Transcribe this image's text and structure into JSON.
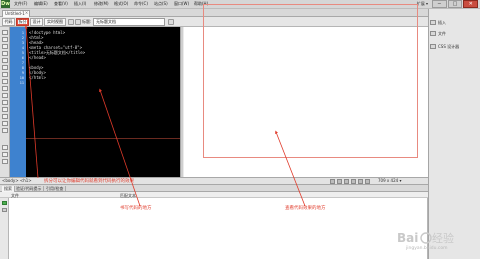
{
  "menubar": {
    "logo": "Dw",
    "items": [
      "文件(F)",
      "编辑(E)",
      "查看(V)",
      "插入(I)",
      "修改(M)",
      "格式(O)",
      "命令(C)",
      "站点(S)",
      "窗口(W)",
      "帮助(H)"
    ],
    "workspace": "扩展 ▾",
    "window_buttons": [
      "−",
      "□",
      "✕"
    ]
  },
  "document": {
    "tab_label": "Untitled-1",
    "tab_close": "×"
  },
  "toolbar": {
    "code": "代码",
    "split": "拆分",
    "design": "设计",
    "live": "实时视图",
    "title_label": "标题:",
    "title_value": "无标题文档"
  },
  "code": {
    "line_numbers": [
      "1",
      "2",
      "3",
      "4",
      "5",
      "6",
      "7",
      "8",
      "9",
      "10",
      "11"
    ],
    "lines": [
      "<!doctype html>",
      "<html>",
      "<head>",
      "<meta charset=\"utf-8\">",
      "<title>无标题文档</title>",
      "</head>",
      "",
      "<body>",
      "</body>",
      "</html>",
      ""
    ]
  },
  "statusbar": {
    "tag_selector": "<body> <h1>",
    "zoom": "709 x 424 ▾"
  },
  "annotations": {
    "split_hint": "拆分可以让你编辑代码就看到代码执行的效果",
    "code_area": "书写代码的地方",
    "preview_area": "查看代码效果的地方"
  },
  "bottom_panel": {
    "tabs": [
      "搜索",
      "验证/代码提示",
      "引用/检查"
    ],
    "col_file": "文件",
    "col_match": "匹配文本"
  },
  "right_panel": {
    "items": [
      "插入",
      "文件",
      "CSS 设计器"
    ]
  },
  "watermark": {
    "text": "jingyan.baidu.com"
  },
  "colors": {
    "line_number_blue": "#3e82cf",
    "code_bg": "#000000",
    "annotation_red": "#e03a2a"
  }
}
